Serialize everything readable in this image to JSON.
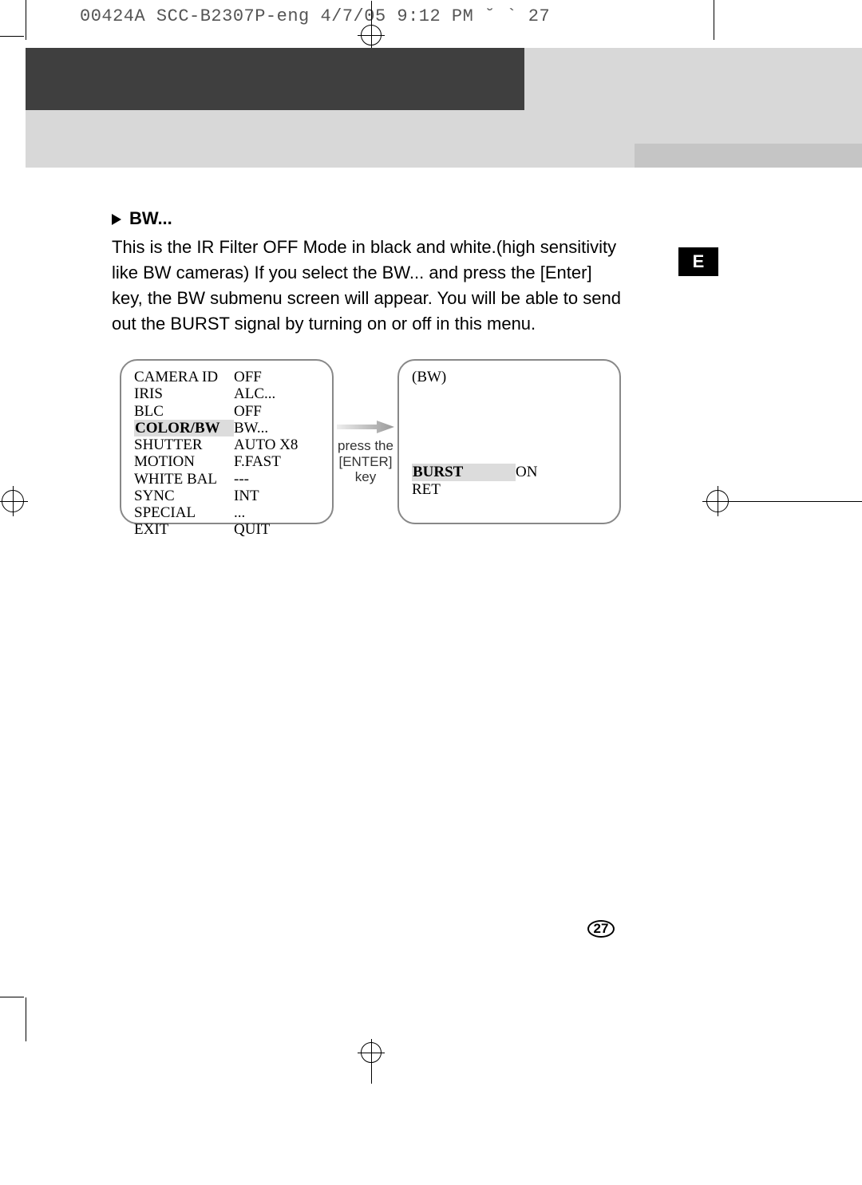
{
  "header": {
    "slug": "00424A SCC-B2307P-eng  4/7/05 9:12 PM  ˘  `  27"
  },
  "side_tab": "E",
  "section": {
    "title": "BW...",
    "paragraph": "This is the IR Filter OFF Mode in black and white.(high sensitivity like BW cameras) If you select the BW... and press the [Enter] key, the BW submenu screen will appear. You will be able to send out the BURST signal by turning on or off in this menu."
  },
  "left_menu": {
    "rows": [
      {
        "label": "CAMERA ID",
        "value": "OFF"
      },
      {
        "label": "IRIS",
        "value": "ALC..."
      },
      {
        "label": "BLC",
        "value": "OFF"
      },
      {
        "label": "COLOR/BW",
        "value": "BW...",
        "highlight_label": true
      },
      {
        "label": "SHUTTER",
        "value": "AUTO X8"
      },
      {
        "label": "MOTION",
        "value": "F.FAST"
      },
      {
        "label": "WHITE BAL",
        "value": "---"
      },
      {
        "label": "SYNC",
        "value": "INT"
      },
      {
        "label": "SPECIAL",
        "value": "..."
      },
      {
        "label": "EXIT",
        "value": "QUIT"
      }
    ]
  },
  "arrow": {
    "line1": "press the",
    "line2": "[ENTER] key"
  },
  "right_menu": {
    "title": "(BW)",
    "rows": [
      {
        "label": "BURST",
        "value": "ON",
        "highlight_label": true
      },
      {
        "label": "RET",
        "value": ""
      }
    ]
  },
  "page_number": "27"
}
